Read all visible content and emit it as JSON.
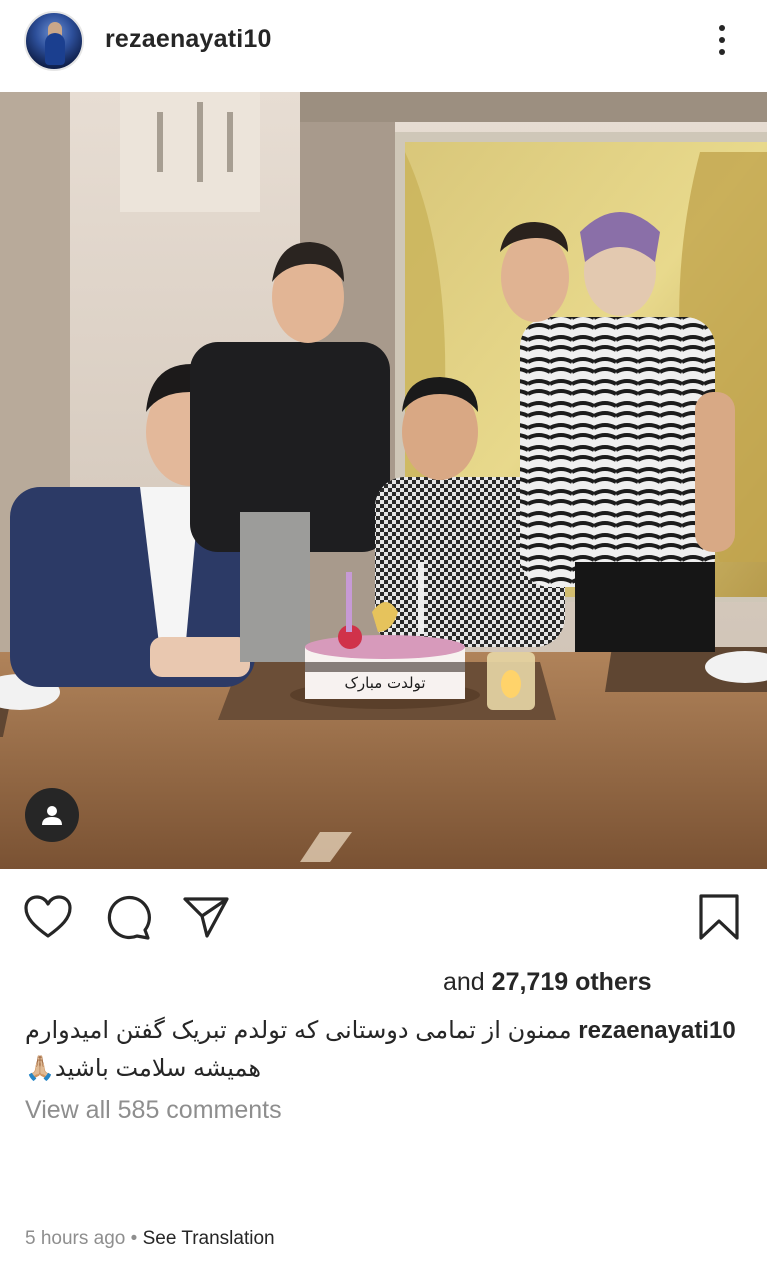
{
  "post": {
    "username": "rezaenayati10",
    "likes": {
      "prefix": "and ",
      "count": "27,719",
      "suffix": " others"
    },
    "caption": {
      "username": "rezaenayati10",
      "text": "ممنون از تمامی دوستانی که تولدم تبریک گفتن امیدوارم همیشه سلامت باشید🙏🏼"
    },
    "view_comments": "View all 585 comments",
    "time_ago": "5 hours ago",
    "separator": "•",
    "see_translation": "See Translation",
    "cake_text": "تولدت مبارک"
  },
  "icons": {
    "more": "more-options-icon",
    "tag": "tagged-user-icon",
    "like": "heart-icon",
    "comment": "comment-icon",
    "share": "share-icon",
    "save": "bookmark-icon"
  },
  "colors": {
    "text": "#262626",
    "secondary": "#8e8e8e",
    "background": "#ffffff"
  }
}
